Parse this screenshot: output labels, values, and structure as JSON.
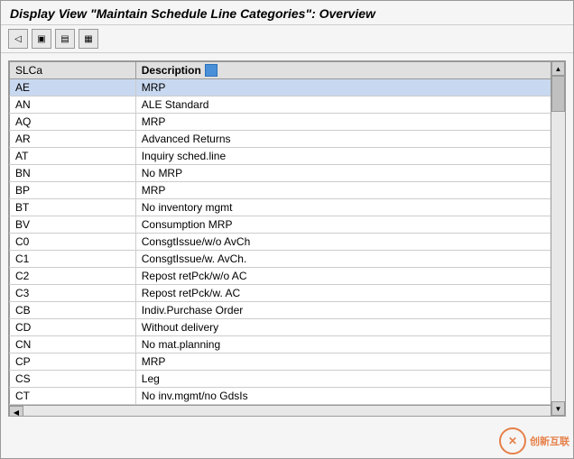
{
  "title": "Display View \"Maintain Schedule Line Categories\": Overview",
  "toolbar": {
    "buttons": [
      {
        "label": "◀",
        "name": "back-button"
      },
      {
        "label": "🖫",
        "name": "save-button"
      },
      {
        "label": "⬛",
        "name": "button3"
      },
      {
        "label": "⬛",
        "name": "button4"
      }
    ]
  },
  "table": {
    "columns": [
      {
        "key": "slca",
        "label": "SLCa"
      },
      {
        "key": "description",
        "label": "Description"
      }
    ],
    "rows": [
      {
        "slca": "AE",
        "description": "MRP",
        "selected": true
      },
      {
        "slca": "AN",
        "description": "ALE Standard",
        "selected": false
      },
      {
        "slca": "AQ",
        "description": "MRP",
        "selected": false
      },
      {
        "slca": "AR",
        "description": "Advanced Returns",
        "selected": false
      },
      {
        "slca": "AT",
        "description": "Inquiry sched.line",
        "selected": false
      },
      {
        "slca": "BN",
        "description": "No MRP",
        "selected": false
      },
      {
        "slca": "BP",
        "description": "MRP",
        "selected": false
      },
      {
        "slca": "BT",
        "description": "No inventory mgmt",
        "selected": false
      },
      {
        "slca": "BV",
        "description": "Consumption MRP",
        "selected": false
      },
      {
        "slca": "C0",
        "description": "ConsgtIssue/w/o AvCh",
        "selected": false
      },
      {
        "slca": "C1",
        "description": "ConsgtIssue/w. AvCh.",
        "selected": false
      },
      {
        "slca": "C2",
        "description": "Repost retPck/w/o AC",
        "selected": false
      },
      {
        "slca": "C3",
        "description": "Repost retPck/w. AC",
        "selected": false
      },
      {
        "slca": "CB",
        "description": "Indiv.Purchase Order",
        "selected": false
      },
      {
        "slca": "CD",
        "description": "Without delivery",
        "selected": false
      },
      {
        "slca": "CN",
        "description": "No mat.planning",
        "selected": false
      },
      {
        "slca": "CP",
        "description": "MRP",
        "selected": false
      },
      {
        "slca": "CS",
        "description": "Leg",
        "selected": false
      },
      {
        "slca": "CT",
        "description": "No inv.mgmt/no GdsIs",
        "selected": false
      }
    ]
  },
  "watermark": {
    "logo": "创新互联",
    "symbol": "✕"
  }
}
